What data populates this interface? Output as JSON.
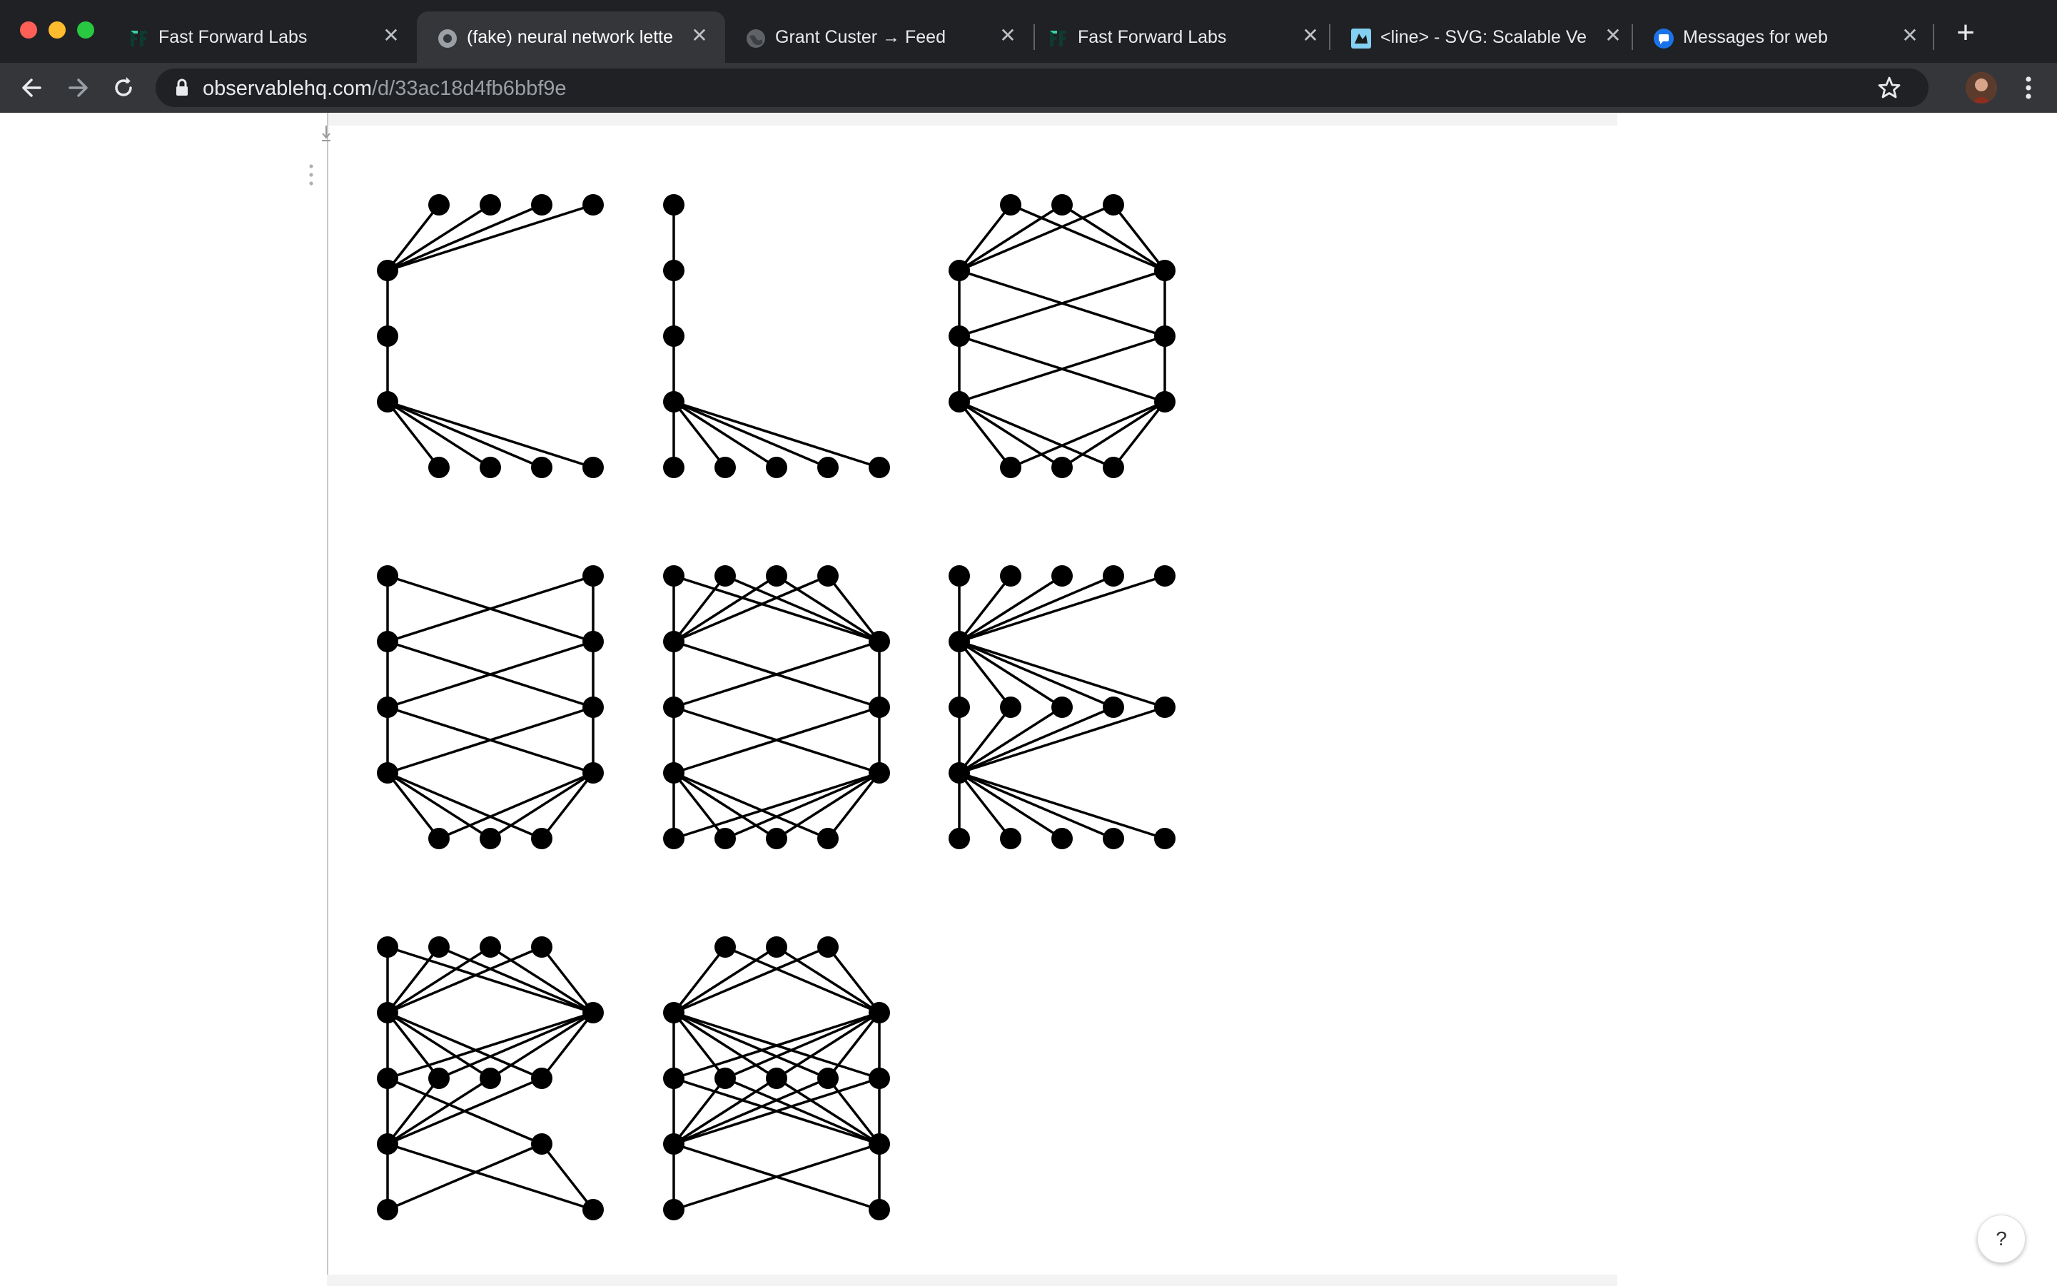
{
  "browser": {
    "tabs": [
      {
        "title": "Fast Forward Labs",
        "icon": "fast-forward-labs-icon",
        "active": false
      },
      {
        "title": "(fake) neural network lette",
        "icon": "observable-icon",
        "active": true
      },
      {
        "title": "Grant Custer → Feed",
        "icon": "globe-icon",
        "active": false
      },
      {
        "title": "Fast Forward Labs",
        "icon": "fast-forward-labs-icon",
        "active": false
      },
      {
        "title": "<line> - SVG: Scalable Ve",
        "icon": "mdn-icon",
        "active": false
      },
      {
        "title": "Messages for web",
        "icon": "messages-icon",
        "active": false
      }
    ],
    "url_host": "observablehq.com",
    "url_path": "/d/33ac18d4fb6bbf9e"
  },
  "page": {
    "help_label": "?",
    "letters": [
      "C",
      "L",
      "O",
      "U",
      "D",
      "E",
      "R",
      "A"
    ]
  },
  "colors": {
    "tab_strip": "#202124",
    "toolbar": "#35363a",
    "network_ink": "#000000"
  }
}
